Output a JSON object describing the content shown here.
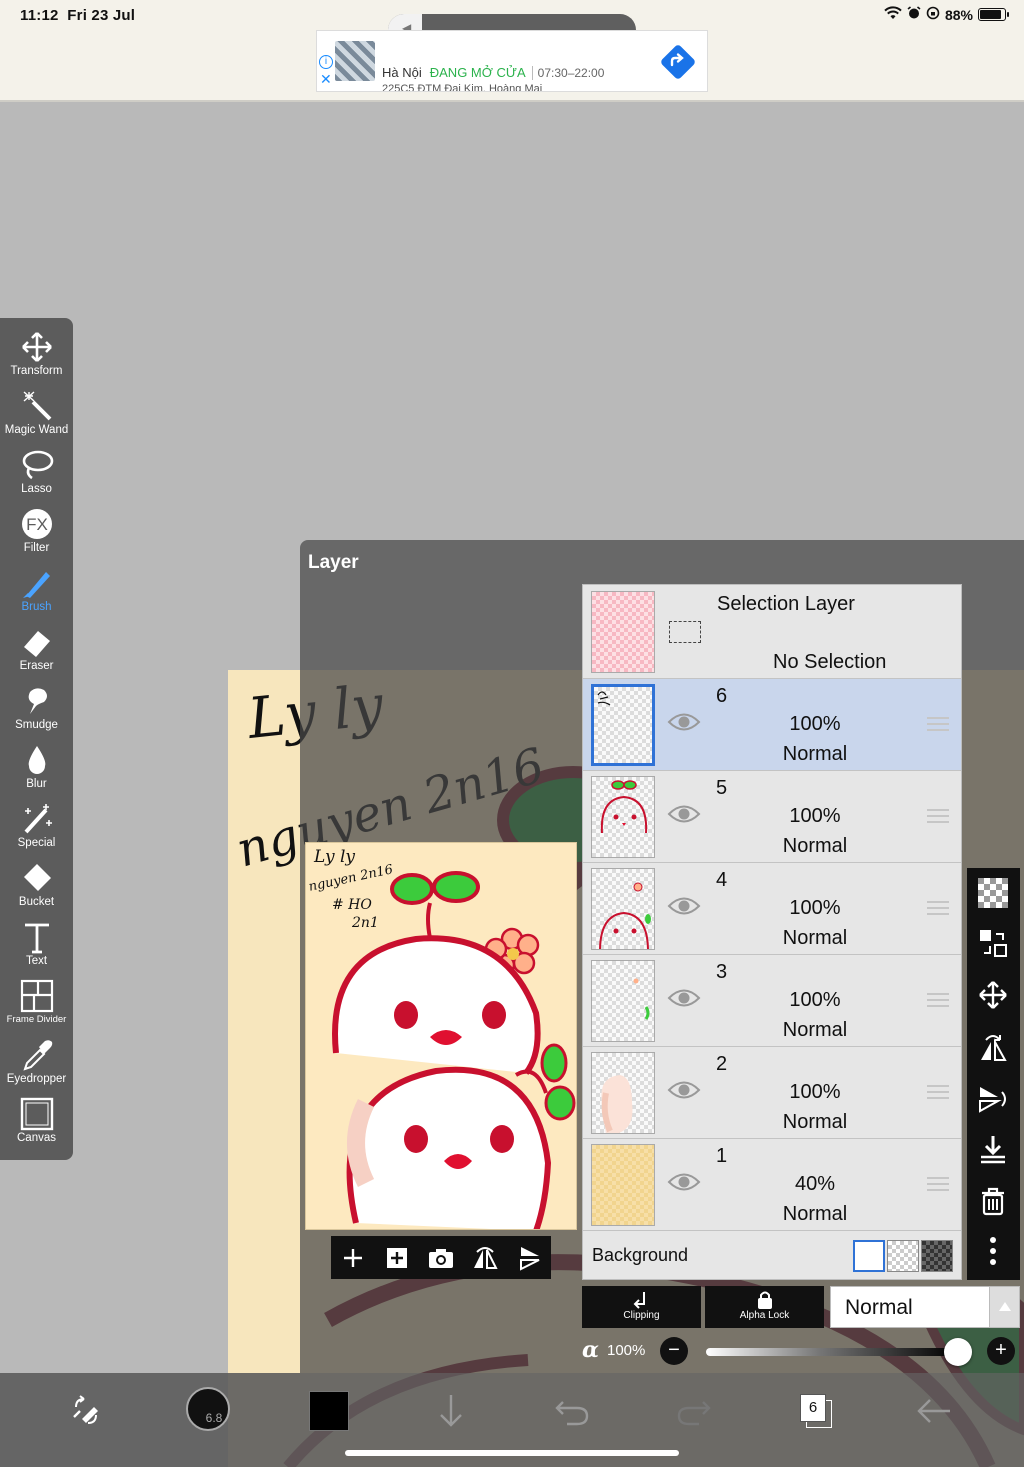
{
  "status_bar": {
    "time": "11:12",
    "date": "Fri 23 Jul",
    "battery": "88%"
  },
  "ad": {
    "city": "Hà Nội",
    "status": "ĐANG MỞ CỬA",
    "hours": "07:30–22:00",
    "address": "225C5 ĐTM Đại Kim, Hoàng Mai"
  },
  "tools": [
    {
      "label": "Transform",
      "icon": "move-icon"
    },
    {
      "label": "Magic Wand",
      "icon": "magic-wand-icon"
    },
    {
      "label": "Lasso",
      "icon": "lasso-icon"
    },
    {
      "label": "Filter",
      "icon": "fx-icon"
    },
    {
      "label": "Brush",
      "icon": "brush-icon"
    },
    {
      "label": "Eraser",
      "icon": "eraser-icon"
    },
    {
      "label": "Smudge",
      "icon": "smudge-icon"
    },
    {
      "label": "Blur",
      "icon": "blur-drop-icon"
    },
    {
      "label": "Special",
      "icon": "special-icon"
    },
    {
      "label": "Bucket",
      "icon": "bucket-icon"
    },
    {
      "label": "Text",
      "icon": "text-icon"
    },
    {
      "label": "Frame Divider",
      "icon": "frame-divider-icon"
    },
    {
      "label": "Eyedropper",
      "icon": "eyedropper-icon"
    },
    {
      "label": "Canvas",
      "icon": "canvas-icon"
    }
  ],
  "active_tool": "Brush",
  "layer_panel": {
    "title": "Layer",
    "selection_layer": {
      "name": "Selection Layer",
      "status": "No Selection"
    },
    "layers": [
      {
        "num": "6",
        "opacity": "100%",
        "blend": "Normal",
        "selected": true
      },
      {
        "num": "5",
        "opacity": "100%",
        "blend": "Normal",
        "selected": false
      },
      {
        "num": "4",
        "opacity": "100%",
        "blend": "Normal",
        "selected": false
      },
      {
        "num": "3",
        "opacity": "100%",
        "blend": "Normal",
        "selected": false
      },
      {
        "num": "2",
        "opacity": "100%",
        "blend": "Normal",
        "selected": false
      },
      {
        "num": "1",
        "opacity": "40%",
        "blend": "Normal",
        "selected": false
      }
    ],
    "background_label": "Background",
    "clipping_label": "Clipping",
    "alpha_lock_label": "Alpha Lock",
    "blend_mode": "Normal",
    "alpha_label": "α",
    "alpha_value": "100%"
  },
  "canvas_text": {
    "line1": "Ly ly",
    "line2": "nguyen 2n16",
    "preview_lines": [
      "Ly ly",
      "nguyen 2n16",
      "# HO",
      "2n1"
    ]
  },
  "bottom_bar": {
    "brush_size": "6.8",
    "layer_count": "6"
  },
  "colors": {
    "accent": "#4aa3ff",
    "selected_layer": "#c9d6ec",
    "primary_color": "#000000",
    "ad_open": "#2bb24c"
  }
}
